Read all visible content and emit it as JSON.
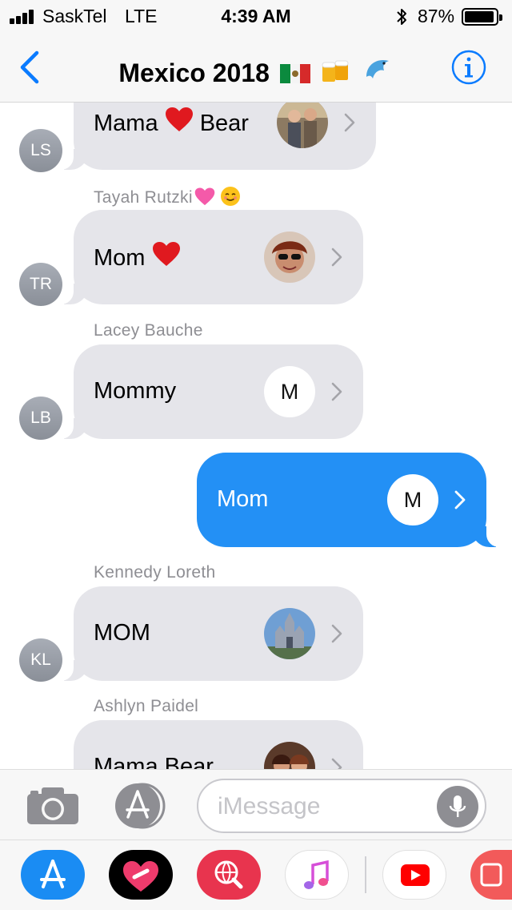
{
  "status_bar": {
    "carrier": "SaskTel",
    "network": "LTE",
    "time": "4:39 AM",
    "battery": "87%",
    "battery_level": 0.87,
    "signal_bars": 4,
    "bluetooth_icon": "bluetooth-icon"
  },
  "nav": {
    "title": "Mexico 2018",
    "title_emojis": [
      "mexico-flag-emoji",
      "beer-mugs-emoji",
      "dolphin-emoji"
    ],
    "back_icon": "chevron-left-icon",
    "info_icon": "info-icon"
  },
  "messages": [
    {
      "direction": "in",
      "sender_name": "",
      "initials": "LS",
      "contact_name": "Mama",
      "contact_name_after": "Bear",
      "heart": true,
      "photo": "contact-photo"
    },
    {
      "direction": "in",
      "sender_name": "Tayah Rutzki",
      "sender_emojis": [
        "pink-heart-emoji",
        "smiling-face-emoji"
      ],
      "initials": "TR",
      "contact_name": "Mom",
      "heart": true,
      "photo": "contact-photo"
    },
    {
      "direction": "in",
      "sender_name": "Lacey Bauche",
      "initials": "LB",
      "contact_name": "Mommy",
      "monogram": "M"
    },
    {
      "direction": "out",
      "contact_name": "Mom",
      "monogram": "M"
    },
    {
      "direction": "in",
      "sender_name": "Kennedy Loreth",
      "initials": "KL",
      "contact_name": "MOM",
      "photo": "contact-photo"
    },
    {
      "direction": "in",
      "sender_name": "Ashlyn Paidel",
      "initials": "",
      "contact_name": "Mama Bear",
      "photo": "contact-photo"
    }
  ],
  "input_bar": {
    "placeholder": "iMessage",
    "camera_icon": "camera-icon",
    "apps_icon": "app-store-icon",
    "mic_icon": "microphone-icon"
  },
  "app_drawer": [
    {
      "name": "app-store-app",
      "icon": "app-store-icon",
      "color": "#1a8cf3"
    },
    {
      "name": "digital-touch-app",
      "icon": "heart-icon",
      "color": "#000000"
    },
    {
      "name": "images-search-app",
      "icon": "globe-search-icon",
      "color": "#e8344e"
    },
    {
      "name": "music-app",
      "icon": "music-note-icon",
      "color": "#ffffff"
    },
    {
      "name": "youtube-app",
      "icon": "youtube-icon",
      "color": "#ffffff"
    },
    {
      "name": "partial-app",
      "icon": "app-icon",
      "color": "#f25a5a"
    }
  ],
  "colors": {
    "accent": "#0a7bff",
    "outgoing_bubble": "#2390f5",
    "incoming_bubble": "#e5e5ea",
    "secondary_text": "#8e8e93"
  }
}
